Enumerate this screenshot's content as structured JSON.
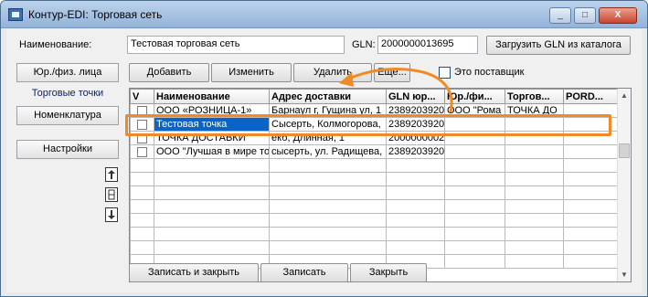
{
  "window": {
    "title": "Контур-EDI: Торговая сеть",
    "min": "_",
    "max": "□",
    "close": "X"
  },
  "form": {
    "name_label": "Наименование:",
    "name_value": "Тестовая торговая сеть",
    "gln_label": "GLN:",
    "gln_value": "2000000013695",
    "load_gln_button": "Загрузить GLN из каталога"
  },
  "sidebar": {
    "items": [
      {
        "label": "Юр./физ. лица"
      },
      {
        "label": "Торговые точки"
      },
      {
        "label": "Номенклатура"
      },
      {
        "label": "Настройки"
      }
    ]
  },
  "toolbar": {
    "add": "Добавить",
    "edit": "Изменить",
    "delete": "Удалить",
    "more": "Еще...",
    "supplier_label": "Это поставщик"
  },
  "table": {
    "headers": [
      "V",
      "Наименование",
      "Адрес доставки",
      "GLN юр...",
      "Юр./фи...",
      "Торгов...",
      "PORD..."
    ],
    "rows": [
      {
        "name": "ООО «РОЗНИЦА-1»",
        "address": "Барнаул г, Гущина ул, 1",
        "gln": "2389203920",
        "legal": "ООО \"Рома",
        "trade": "ТОЧКА ДО",
        "pord": ""
      },
      {
        "name": "Тестовая точка",
        "address": "Сысерть, Колмогорова,",
        "gln": "2389203920",
        "legal": "",
        "trade": "",
        "pord": ""
      },
      {
        "name": "ТОЧКА ДОСТАВКИ",
        "address": "екб, Длинная, 1",
        "gln": "2000000002",
        "legal": "",
        "trade": "",
        "pord": ""
      },
      {
        "name": "ООО \"Лучшая в мире то",
        "address": "сысерть, ул. Радищева,",
        "gln": "2389203920",
        "legal": "",
        "trade": "",
        "pord": ""
      }
    ]
  },
  "footer": {
    "save_close": "Записать и закрыть",
    "save": "Записать",
    "close": "Закрыть"
  }
}
